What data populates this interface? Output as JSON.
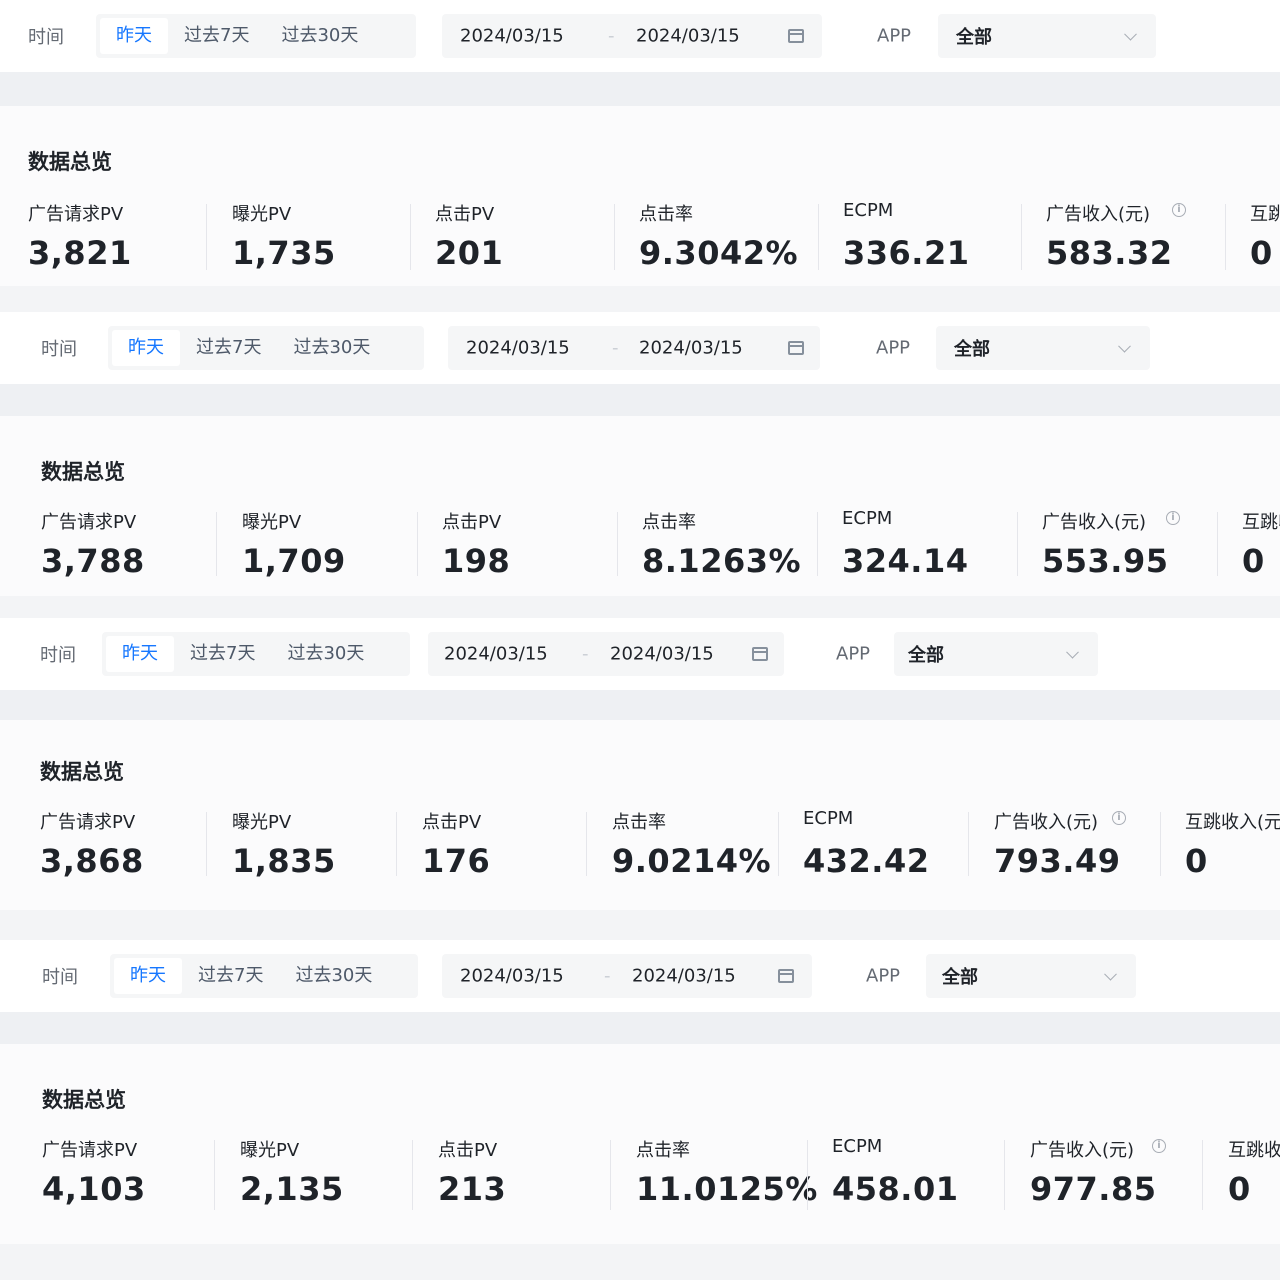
{
  "panels": [
    {
      "filter": {
        "time_label": "时间",
        "presets": [
          "昨天",
          "过去7天",
          "过去30天"
        ],
        "active_preset": "昨天",
        "start_date": "2024/03/15",
        "end_date": "2024/03/15",
        "app_label": "APP",
        "app_value": "全部"
      },
      "overview_title": "数据总览",
      "metrics": [
        {
          "label": "广告请求PV",
          "value": "3,821"
        },
        {
          "label": "曝光PV",
          "value": "1,735"
        },
        {
          "label": "点击PV",
          "value": "201"
        },
        {
          "label": "点击率",
          "value": "9.3042%"
        },
        {
          "label": "ECPM",
          "value": "336.21"
        },
        {
          "label": "广告收入(元)",
          "value": "583.32"
        },
        {
          "label": "互跳收入(元)",
          "value": "0"
        }
      ]
    },
    {
      "filter": {
        "time_label": "时间",
        "presets": [
          "昨天",
          "过去7天",
          "过去30天"
        ],
        "active_preset": "昨天",
        "start_date": "2024/03/15",
        "end_date": "2024/03/15",
        "app_label": "APP",
        "app_value": "全部"
      },
      "overview_title": "数据总览",
      "metrics": [
        {
          "label": "广告请求PV",
          "value": "3,788"
        },
        {
          "label": "曝光PV",
          "value": "1,709"
        },
        {
          "label": "点击PV",
          "value": "198"
        },
        {
          "label": "点击率",
          "value": "8.1263%"
        },
        {
          "label": "ECPM",
          "value": "324.14"
        },
        {
          "label": "广告收入(元)",
          "value": "553.95"
        },
        {
          "label": "互跳收入(元)",
          "value": "0"
        }
      ]
    },
    {
      "filter": {
        "time_label": "时间",
        "presets": [
          "昨天",
          "过去7天",
          "过去30天"
        ],
        "active_preset": "昨天",
        "start_date": "2024/03/15",
        "end_date": "2024/03/15",
        "app_label": "APP",
        "app_value": "全部"
      },
      "overview_title": "数据总览",
      "metrics": [
        {
          "label": "广告请求PV",
          "value": "3,868"
        },
        {
          "label": "曝光PV",
          "value": "1,835"
        },
        {
          "label": "点击PV",
          "value": "176"
        },
        {
          "label": "点击率",
          "value": "9.0214%"
        },
        {
          "label": "ECPM",
          "value": "432.42"
        },
        {
          "label": "广告收入(元)",
          "value": "793.49"
        },
        {
          "label": "互跳收入(元)",
          "value": "0"
        }
      ]
    },
    {
      "filter": {
        "time_label": "时间",
        "presets": [
          "昨天",
          "过去7天",
          "过去30天"
        ],
        "active_preset": "昨天",
        "start_date": "2024/03/15",
        "end_date": "2024/03/15",
        "app_label": "APP",
        "app_value": "全部"
      },
      "overview_title": "数据总览",
      "metrics": [
        {
          "label": "广告请求PV",
          "value": "4,103"
        },
        {
          "label": "曝光PV",
          "value": "2,135"
        },
        {
          "label": "点击PV",
          "value": "213"
        },
        {
          "label": "点击率",
          "value": "11.0125%"
        },
        {
          "label": "ECPM",
          "value": "458.01"
        },
        {
          "label": "广告收入(元)",
          "value": "977.85"
        },
        {
          "label": "互跳收入(元)",
          "value": "0"
        }
      ]
    }
  ]
}
